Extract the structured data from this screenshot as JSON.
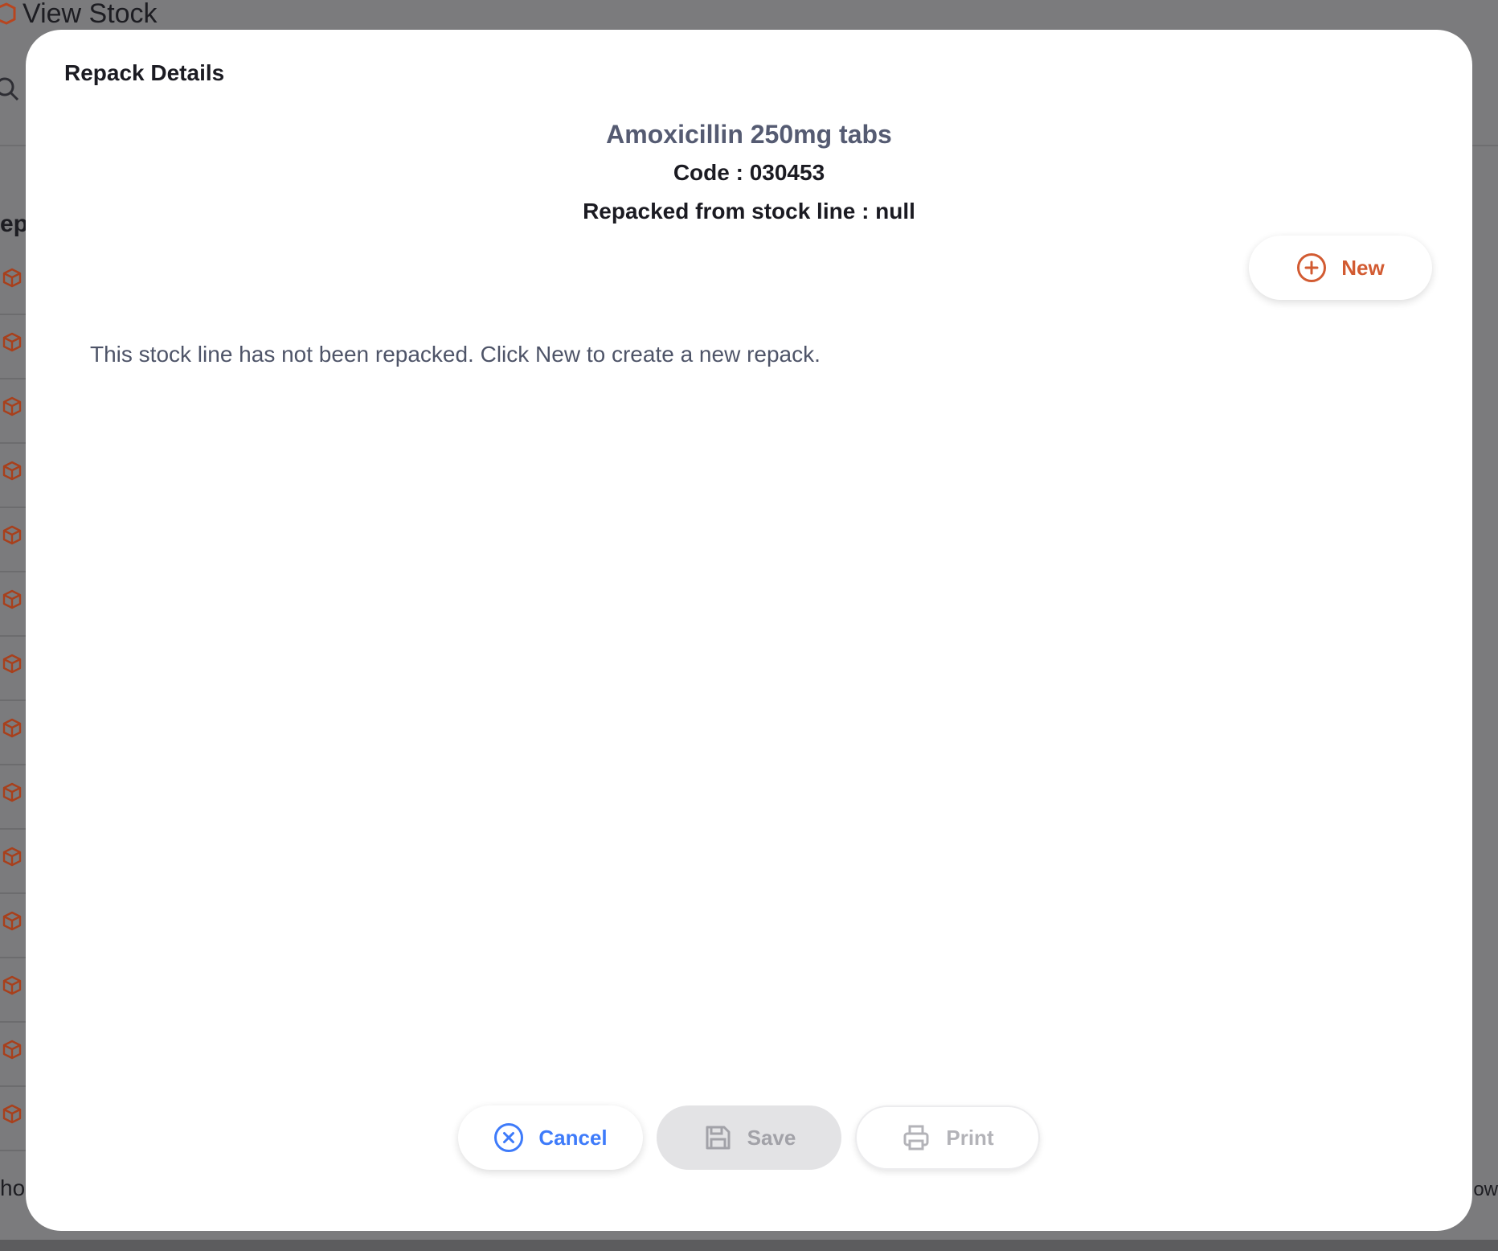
{
  "background": {
    "page_title": "View Stock",
    "column_header_partial": "epa",
    "footer_left_partial": "ho",
    "footer_right_partial": "ow",
    "row_icon": "package-icon"
  },
  "modal": {
    "title": "Repack Details",
    "item_name": "Amoxicillin 250mg tabs",
    "item_code": "Code : 030453",
    "repacked_from": "Repacked from stock line : null",
    "new_button_label": "New",
    "empty_message": "This stock line has not been repacked. Click New to create a new repack.",
    "footer": {
      "cancel_label": "Cancel",
      "save_label": "Save",
      "print_label": "Print"
    }
  },
  "colors": {
    "accent_orange": "#d25b32",
    "accent_blue": "#3e7bfa",
    "disabled_gray": "#a2a2a8"
  }
}
